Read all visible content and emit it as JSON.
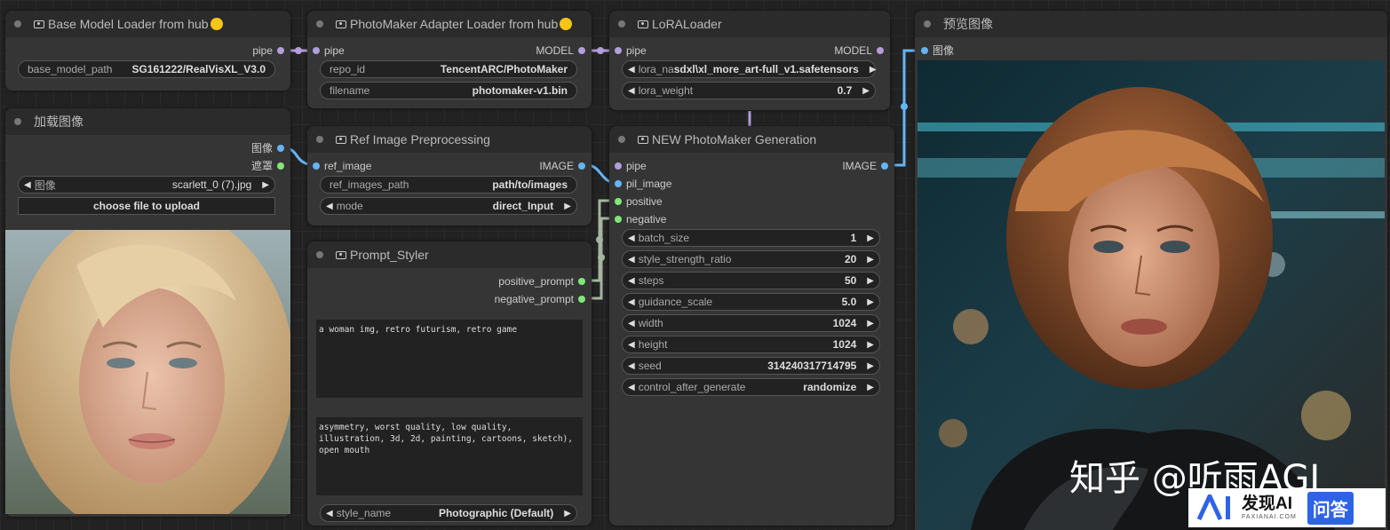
{
  "nodes": {
    "base_loader": {
      "title": "Base Model Loader from hub",
      "output_pipe": "pipe",
      "base_model_path_label": "base_model_path",
      "base_model_path_value": "SG161222/RealVisXL_V3.0"
    },
    "load_image": {
      "title": "加载图像",
      "output_image": "图像",
      "output_mask": "遮罩",
      "image_label": "图像",
      "image_value": "scarlett_0 (7).jpg",
      "upload_label": "choose file to upload"
    },
    "adapter_loader": {
      "title": "PhotoMaker Adapter Loader from hub",
      "input_pipe": "pipe",
      "output_model": "MODEL",
      "repo_id_label": "repo_id",
      "repo_id_value": "TencentARC/PhotoMaker",
      "filename_label": "filename",
      "filename_value": "photomaker-v1.bin"
    },
    "ref_preprocess": {
      "title": "Ref Image Preprocessing",
      "input_ref_image": "ref_image",
      "output_image": "IMAGE",
      "ref_images_path_label": "ref_images_path",
      "ref_images_path_value": "path/to/images",
      "mode_label": "mode",
      "mode_value": "direct_Input"
    },
    "prompt_styler": {
      "title": "Prompt_Styler",
      "output_positive": "positive_prompt",
      "output_negative": "negative_prompt",
      "positive_text": "a woman img, retro futurism, retro game",
      "negative_text": "asymmetry, worst quality, low quality, illustration, 3d, 2d, painting, cartoons, sketch), open mouth",
      "style_name_label": "style_name",
      "style_name_value": "Photographic (Default)"
    },
    "lora_loader": {
      "title": "LoRALoader",
      "input_pipe": "pipe",
      "output_model": "MODEL",
      "lora_name_label": "lora_na",
      "lora_name_value": "sdxl\\xl_more_art-full_v1.safetensors",
      "lora_weight_label": "lora_weight",
      "lora_weight_value": "0.7"
    },
    "generation": {
      "title": "NEW PhotoMaker Generation",
      "input_pipe": "pipe",
      "input_pil_image": "pil_image",
      "input_positive": "positive",
      "input_negative": "negative",
      "output_image": "IMAGE",
      "widgets": [
        {
          "label": "batch_size",
          "value": "1"
        },
        {
          "label": "style_strength_ratio",
          "value": "20"
        },
        {
          "label": "steps",
          "value": "50"
        },
        {
          "label": "guidance_scale",
          "value": "5.0"
        },
        {
          "label": "width",
          "value": "1024"
        },
        {
          "label": "height",
          "value": "1024"
        },
        {
          "label": "seed",
          "value": "314240317714795"
        },
        {
          "label": "control_after_generate",
          "value": "randomize"
        }
      ]
    },
    "preview": {
      "title": "预览图像",
      "input_image": "图像"
    }
  },
  "watermark": {
    "zhihu": "知乎 @听雨AGI",
    "badge_brand": "发现AI",
    "badge_sub": "FAXIANAI.COM",
    "badge_qa": "问答"
  },
  "colors": {
    "canvas_bg": "#222222",
    "node_bg": "#353535",
    "node_title_bg": "#2b2b2b",
    "pipe_wire": "#b39ddb",
    "image_wire": "#64b5f6",
    "conditioning_wire": "#a5b5a0"
  }
}
